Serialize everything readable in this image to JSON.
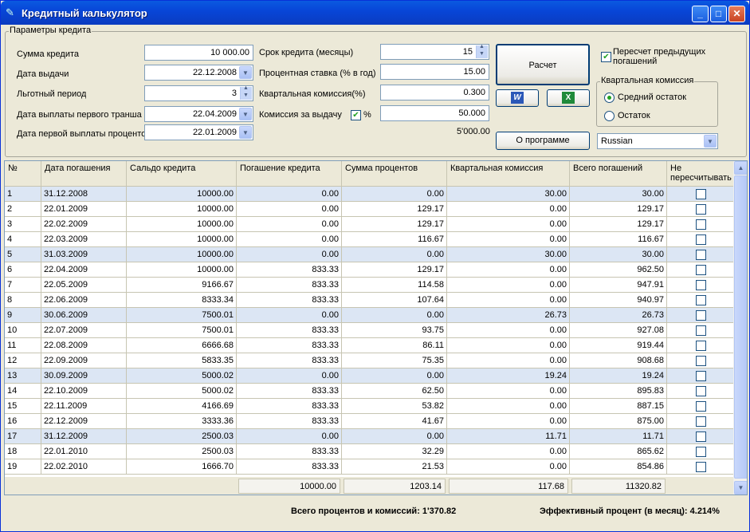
{
  "window": {
    "title": "Кредитный калькулятор"
  },
  "params": {
    "group_label": "Параметры кредита",
    "loan_amount_label": "Сумма кредита",
    "loan_amount": "10 000.00",
    "issue_date_label": "Дата выдачи",
    "issue_date": "22.12.2008",
    "grace_label": "Льготный период",
    "grace": "3",
    "first_tranche_label": "Дата выплаты первого транша",
    "first_tranche": "22.04.2009",
    "first_interest_label": "Дата первой выплаты процентов",
    "first_interest": "22.01.2009",
    "term_label": "Срок кредита (месяцы)",
    "term": "15",
    "rate_label": "Процентная ставка (% в год)",
    "rate": "15.00",
    "quarterly_fee_label": "Квартальная комиссия(%)",
    "quarterly_fee": "0.300",
    "issue_fee_label": "Комиссия за выдачу",
    "issue_fee_pct_label": "%",
    "issue_fee_pct_checked": true,
    "issue_fee": "50.000",
    "issue_fee_total": "5'000.00"
  },
  "buttons": {
    "calc": "Расчет",
    "word_icon": "W",
    "excel_icon": "X",
    "about": "О программе"
  },
  "options": {
    "recalc_label": "Пересчет предыдущих погашений",
    "recalc_checked": true,
    "quarterly_group": "Квартальная комиссия",
    "avg_balance": "Средний остаток",
    "balance": "Остаток",
    "language": "Russian"
  },
  "table": {
    "headers": [
      "№",
      "Дата погашения",
      "Сальдо кредита",
      "Погашение кредита",
      "Сумма процентов",
      "Квартальная комиссия",
      "Всего погашений",
      "Не пересчитывать"
    ],
    "rows": [
      [
        "1",
        "31.12.2008",
        "10000.00",
        "0.00",
        "0.00",
        "30.00",
        "30.00"
      ],
      [
        "2",
        "22.01.2009",
        "10000.00",
        "0.00",
        "129.17",
        "0.00",
        "129.17"
      ],
      [
        "3",
        "22.02.2009",
        "10000.00",
        "0.00",
        "129.17",
        "0.00",
        "129.17"
      ],
      [
        "4",
        "22.03.2009",
        "10000.00",
        "0.00",
        "116.67",
        "0.00",
        "116.67"
      ],
      [
        "5",
        "31.03.2009",
        "10000.00",
        "0.00",
        "0.00",
        "30.00",
        "30.00"
      ],
      [
        "6",
        "22.04.2009",
        "10000.00",
        "833.33",
        "129.17",
        "0.00",
        "962.50"
      ],
      [
        "7",
        "22.05.2009",
        "9166.67",
        "833.33",
        "114.58",
        "0.00",
        "947.91"
      ],
      [
        "8",
        "22.06.2009",
        "8333.34",
        "833.33",
        "107.64",
        "0.00",
        "940.97"
      ],
      [
        "9",
        "30.06.2009",
        "7500.01",
        "0.00",
        "0.00",
        "26.73",
        "26.73"
      ],
      [
        "10",
        "22.07.2009",
        "7500.01",
        "833.33",
        "93.75",
        "0.00",
        "927.08"
      ],
      [
        "11",
        "22.08.2009",
        "6666.68",
        "833.33",
        "86.11",
        "0.00",
        "919.44"
      ],
      [
        "12",
        "22.09.2009",
        "5833.35",
        "833.33",
        "75.35",
        "0.00",
        "908.68"
      ],
      [
        "13",
        "30.09.2009",
        "5000.02",
        "0.00",
        "0.00",
        "19.24",
        "19.24"
      ],
      [
        "14",
        "22.10.2009",
        "5000.02",
        "833.33",
        "62.50",
        "0.00",
        "895.83"
      ],
      [
        "15",
        "22.11.2009",
        "4166.69",
        "833.33",
        "53.82",
        "0.00",
        "887.15"
      ],
      [
        "16",
        "22.12.2009",
        "3333.36",
        "833.33",
        "41.67",
        "0.00",
        "875.00"
      ],
      [
        "17",
        "31.12.2009",
        "2500.03",
        "0.00",
        "0.00",
        "11.71",
        "11.71"
      ],
      [
        "18",
        "22.01.2010",
        "2500.03",
        "833.33",
        "32.29",
        "0.00",
        "865.62"
      ],
      [
        "19",
        "22.02.2010",
        "1666.70",
        "833.33",
        "21.53",
        "0.00",
        "854.86"
      ]
    ],
    "alt_rows": [
      0,
      4,
      8,
      12,
      16
    ],
    "totals": [
      "10000.00",
      "1203.14",
      "117.68",
      "11320.82"
    ]
  },
  "footer": {
    "total_interest": "Всего процентов и комиссий: 1'370.82",
    "effective_rate": "Эффективный процент (в месяц): 4.214%"
  }
}
